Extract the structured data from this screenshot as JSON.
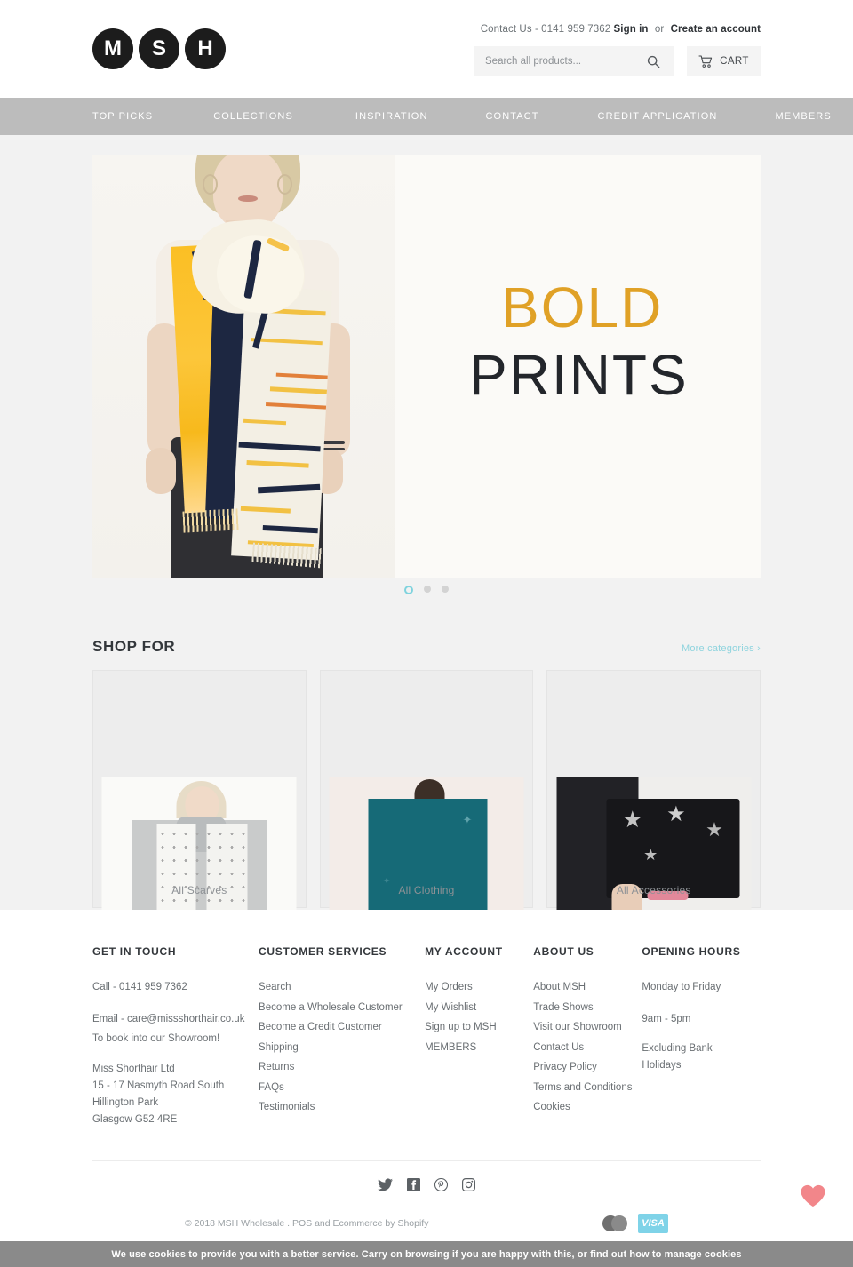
{
  "brand": {
    "logo_letters": [
      "M",
      "S",
      "H"
    ]
  },
  "header": {
    "contact": "Contact Us - 0141 959 7362",
    "sign_in": "Sign in",
    "or": "or",
    "create_account": "Create an account",
    "search_placeholder": "Search all products...",
    "search_value": "",
    "search_icon": "search-icon",
    "cart_label": "CART",
    "cart_icon": "cart-icon"
  },
  "nav": {
    "items": [
      {
        "label": "TOP PICKS"
      },
      {
        "label": "COLLECTIONS"
      },
      {
        "label": "INSPIRATION"
      },
      {
        "label": "CONTACT"
      },
      {
        "label": "CREDIT APPLICATION"
      },
      {
        "label": "MEMBERS"
      }
    ]
  },
  "hero": {
    "line1": "BOLD",
    "line2": "PRINTS",
    "line1_color": "#e0a126",
    "line2_color": "#23262b",
    "slides": 3,
    "active_slide": 1,
    "active_dot_color": "#7fd3de"
  },
  "shop": {
    "title": "SHOP FOR",
    "more_link": "More categories ›",
    "more_link_color": "#8fd4de",
    "cards": [
      {
        "label": "All Scarves"
      },
      {
        "label": "All Clothing"
      },
      {
        "label": "All Accessories"
      }
    ]
  },
  "footer": {
    "columns": [
      {
        "heading": "GET IN TOUCH",
        "phone": "Call - 0141 959 7362",
        "email": "Email - care@missshorthair.co.uk",
        "showroom": "To book into our Showroom!",
        "address": [
          "Miss Shorthair Ltd",
          "15 - 17 Nasmyth Road South",
          "Hillington Park",
          "Glasgow G52 4RE"
        ]
      },
      {
        "heading": "CUSTOMER SERVICES",
        "links": [
          "Search",
          "Become a Wholesale Customer",
          "Become a Credit Customer",
          "Shipping",
          "Returns",
          "FAQs",
          "Testimonials"
        ]
      },
      {
        "heading": "MY ACCOUNT",
        "links": [
          "My Orders",
          "My Wishlist",
          "Sign up to MSH",
          "MEMBERS"
        ]
      },
      {
        "heading": "ABOUT US",
        "links": [
          "About MSH",
          "Trade Shows",
          "Visit our Showroom",
          "Contact Us",
          "Privacy Policy",
          "Terms and Conditions",
          "Cookies"
        ]
      },
      {
        "heading": "OPENING HOURS",
        "lines": [
          "Monday to Friday",
          "9am - 5pm",
          "Excluding Bank",
          "Holidays"
        ]
      }
    ],
    "social": [
      {
        "name": "twitter-icon"
      },
      {
        "name": "facebook-icon"
      },
      {
        "name": "pinterest-icon"
      },
      {
        "name": "instagram-icon"
      }
    ],
    "copyright": "© 2018 MSH Wholesale",
    "pos_text": ". POS and Ecommerce by Shopify",
    "payment_icons": [
      "mastercard-icon",
      "visa-icon"
    ],
    "visa_label": "VISA"
  },
  "widgets": {
    "wishlist_heart_color": "#f2868a"
  },
  "cookie": {
    "text": "We use cookies to provide you with a better service. Carry on browsing if you are happy with this, or find out how to manage cookies"
  }
}
